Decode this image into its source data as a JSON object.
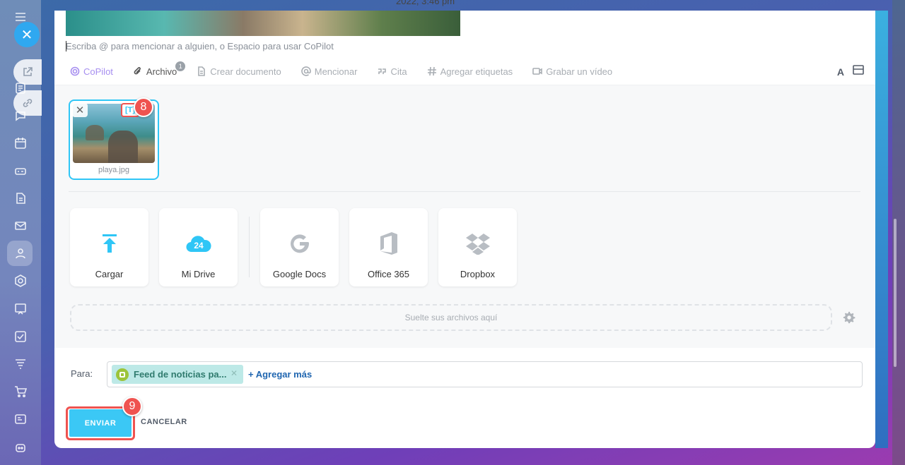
{
  "header": {
    "date_fragment": "2022, 3:46 pm"
  },
  "editor": {
    "placeholder": "Escriba @ para mencionar a alguien, o Espacio para usar CoPilot"
  },
  "toolbar": {
    "items": [
      {
        "label": "CoPilot",
        "icon": "copilot-icon"
      },
      {
        "label": "Archivo",
        "icon": "paperclip-icon",
        "badge": "1"
      },
      {
        "label": "Crear documento",
        "icon": "document-icon"
      },
      {
        "label": "Mencionar",
        "icon": "at-icon"
      },
      {
        "label": "Cita",
        "icon": "quote-icon"
      },
      {
        "label": "Agregar etiquetas",
        "icon": "hashtag-icon"
      },
      {
        "label": "Grabar un vídeo",
        "icon": "video-icon"
      }
    ],
    "font_button": "A"
  },
  "attachments": {
    "files": [
      {
        "name": "playa.jpg",
        "edit_icon": "[T]"
      }
    ],
    "sources": [
      {
        "label": "Cargar",
        "icon": "upload-icon"
      },
      {
        "label": "Mi Drive",
        "icon": "cloud-drive-icon",
        "icon_text": "24"
      },
      {
        "label": "Google Docs",
        "icon": "google-icon"
      },
      {
        "label": "Office 365",
        "icon": "office-icon"
      },
      {
        "label": "Dropbox",
        "icon": "dropbox-icon"
      }
    ],
    "dropzone_text": "Suelte sus archivos aquí"
  },
  "recipients": {
    "label": "Para:",
    "chip": "Feed de noticias pa...",
    "add_more": "+ Agregar más"
  },
  "actions": {
    "send": "ENVIAR",
    "cancel": "CANCELAR"
  },
  "steps": {
    "step_8": "8",
    "step_9": "9"
  },
  "colors": {
    "accent": "#2fc6f6",
    "send_button": "#3bc8f5",
    "step_marker": "#ef5350",
    "copilot": "#a78ff0"
  }
}
